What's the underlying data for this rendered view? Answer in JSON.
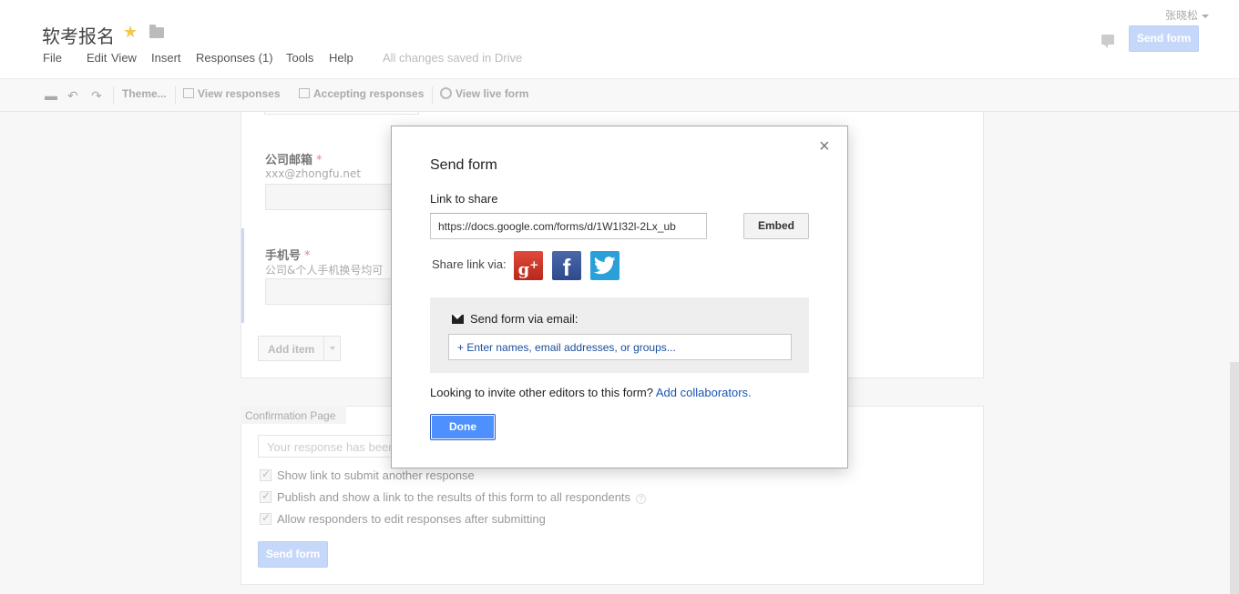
{
  "header": {
    "doc_title": "软考报名",
    "menu": [
      "File",
      "Edit",
      "View",
      "Insert",
      "Responses (1)",
      "Tools",
      "Help"
    ],
    "save_status": "All changes saved in Drive",
    "user_name": "张晓松",
    "send_form_label": "Send form"
  },
  "toolbar": {
    "theme_label": "Theme...",
    "view_responses_label": "View responses",
    "accepting_responses_label": "Accepting responses",
    "view_live_form_label": "View live form"
  },
  "form": {
    "questions": [
      {
        "title": "公司邮箱",
        "required_mark": "*",
        "help": "xxx@zhongfu.net"
      },
      {
        "title": "手机号",
        "required_mark": "*",
        "help": "公司&个人手机换号均可"
      }
    ],
    "add_item_label": "Add item"
  },
  "confirmation": {
    "tab_label": "Confirmation Page",
    "message_placeholder": "Your response has been",
    "options": [
      "Show link to submit another response",
      "Publish and show a link to the results of this form to all respondents",
      "Allow responders to edit responses after submitting"
    ],
    "send_form_label": "Send form"
  },
  "dialog": {
    "close_glyph": "×",
    "title": "Send form",
    "link_label": "Link to share",
    "link_value": "https://docs.google.com/forms/d/1W1I32l-2Lx_ub",
    "embed_label": "Embed",
    "share_via_label": "Share link via:",
    "social_icons": [
      "google-plus-icon",
      "facebook-icon",
      "twitter-icon"
    ],
    "email_section_title": "Send form via email:",
    "email_placeholder": "+ Enter names, email addresses, or groups...",
    "invite_text": "Looking to invite other editors to this form?",
    "invite_link": "Add collaborators.",
    "done_label": "Done"
  },
  "colors": {
    "accent_blue": "#4d90fe",
    "link_blue": "#1a55b5",
    "disabled_blue": "#c6d8fa",
    "star_yellow": "#f2c94c"
  }
}
